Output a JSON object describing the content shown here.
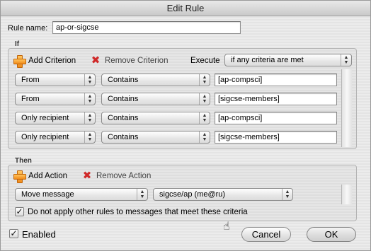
{
  "window": {
    "title": "Edit Rule"
  },
  "rule_name": {
    "label": "Rule name:",
    "value": "ap-or-sigcse"
  },
  "if_section": {
    "label": "If",
    "add_label": "Add Criterion",
    "remove_label": "Remove Criterion",
    "execute_label": "Execute",
    "execute_value": "if any criteria are met",
    "criteria": [
      {
        "field": "From",
        "operator": "Contains",
        "value": "[ap-compsci]"
      },
      {
        "field": "From",
        "operator": "Contains",
        "value": "[sigcse-members]"
      },
      {
        "field": "Only recipient",
        "operator": "Contains",
        "value": "[ap-compsci]"
      },
      {
        "field": "Only recipient",
        "operator": "Contains",
        "value": "[sigcse-members]"
      }
    ]
  },
  "then_section": {
    "label": "Then",
    "add_label": "Add Action",
    "remove_label": "Remove Action",
    "actions": [
      {
        "action": "Move message",
        "target": "sigcse/ap (me@ru)"
      }
    ],
    "stop_rules_label": "Do not apply other rules to messages that meet these criteria",
    "stop_rules_checked": true
  },
  "footer": {
    "enabled_label": "Enabled",
    "enabled_checked": true,
    "cancel_label": "Cancel",
    "ok_label": "OK"
  },
  "icons": {
    "add": "plus-icon",
    "remove": "x-icon",
    "popup_arrows": "updown-arrows-icon",
    "checkmark": "checkmark-icon",
    "cursor": "hand-pointer-icon"
  },
  "colors": {
    "add_icon": "#f08b1b",
    "remove_icon": "#d02a2a"
  }
}
